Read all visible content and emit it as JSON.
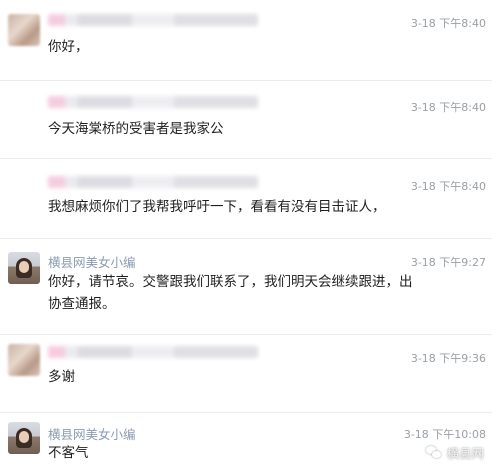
{
  "messages": [
    {
      "sender": "",
      "time": "3-18 下午8:40",
      "text": "你好，",
      "avatar": "blurred"
    },
    {
      "sender": "",
      "time": "3-18 下午8:40",
      "text": "今天海棠桥的受害者是我家公",
      "avatar": "none"
    },
    {
      "sender": "",
      "time": "3-18 下午8:40",
      "text": "我想麻烦你们了我帮我呼吁一下，看看有没有目击证人，",
      "avatar": "none"
    },
    {
      "sender": "横县网美女小编",
      "time": "3-18 下午9:27",
      "text": "你好，请节哀。交警跟我们联系了，我们明天会继续跟进，出协查通报。",
      "avatar": "photo"
    },
    {
      "sender": "",
      "time": "3-18 下午9:36",
      "text": "多谢",
      "avatar": "blurred"
    },
    {
      "sender": "横县网美女小编",
      "time": "3-18 下午10:08",
      "text": "不客气",
      "avatar": "photo"
    }
  ],
  "watermark": {
    "icon": "wechat-icon",
    "label": "横县网"
  }
}
